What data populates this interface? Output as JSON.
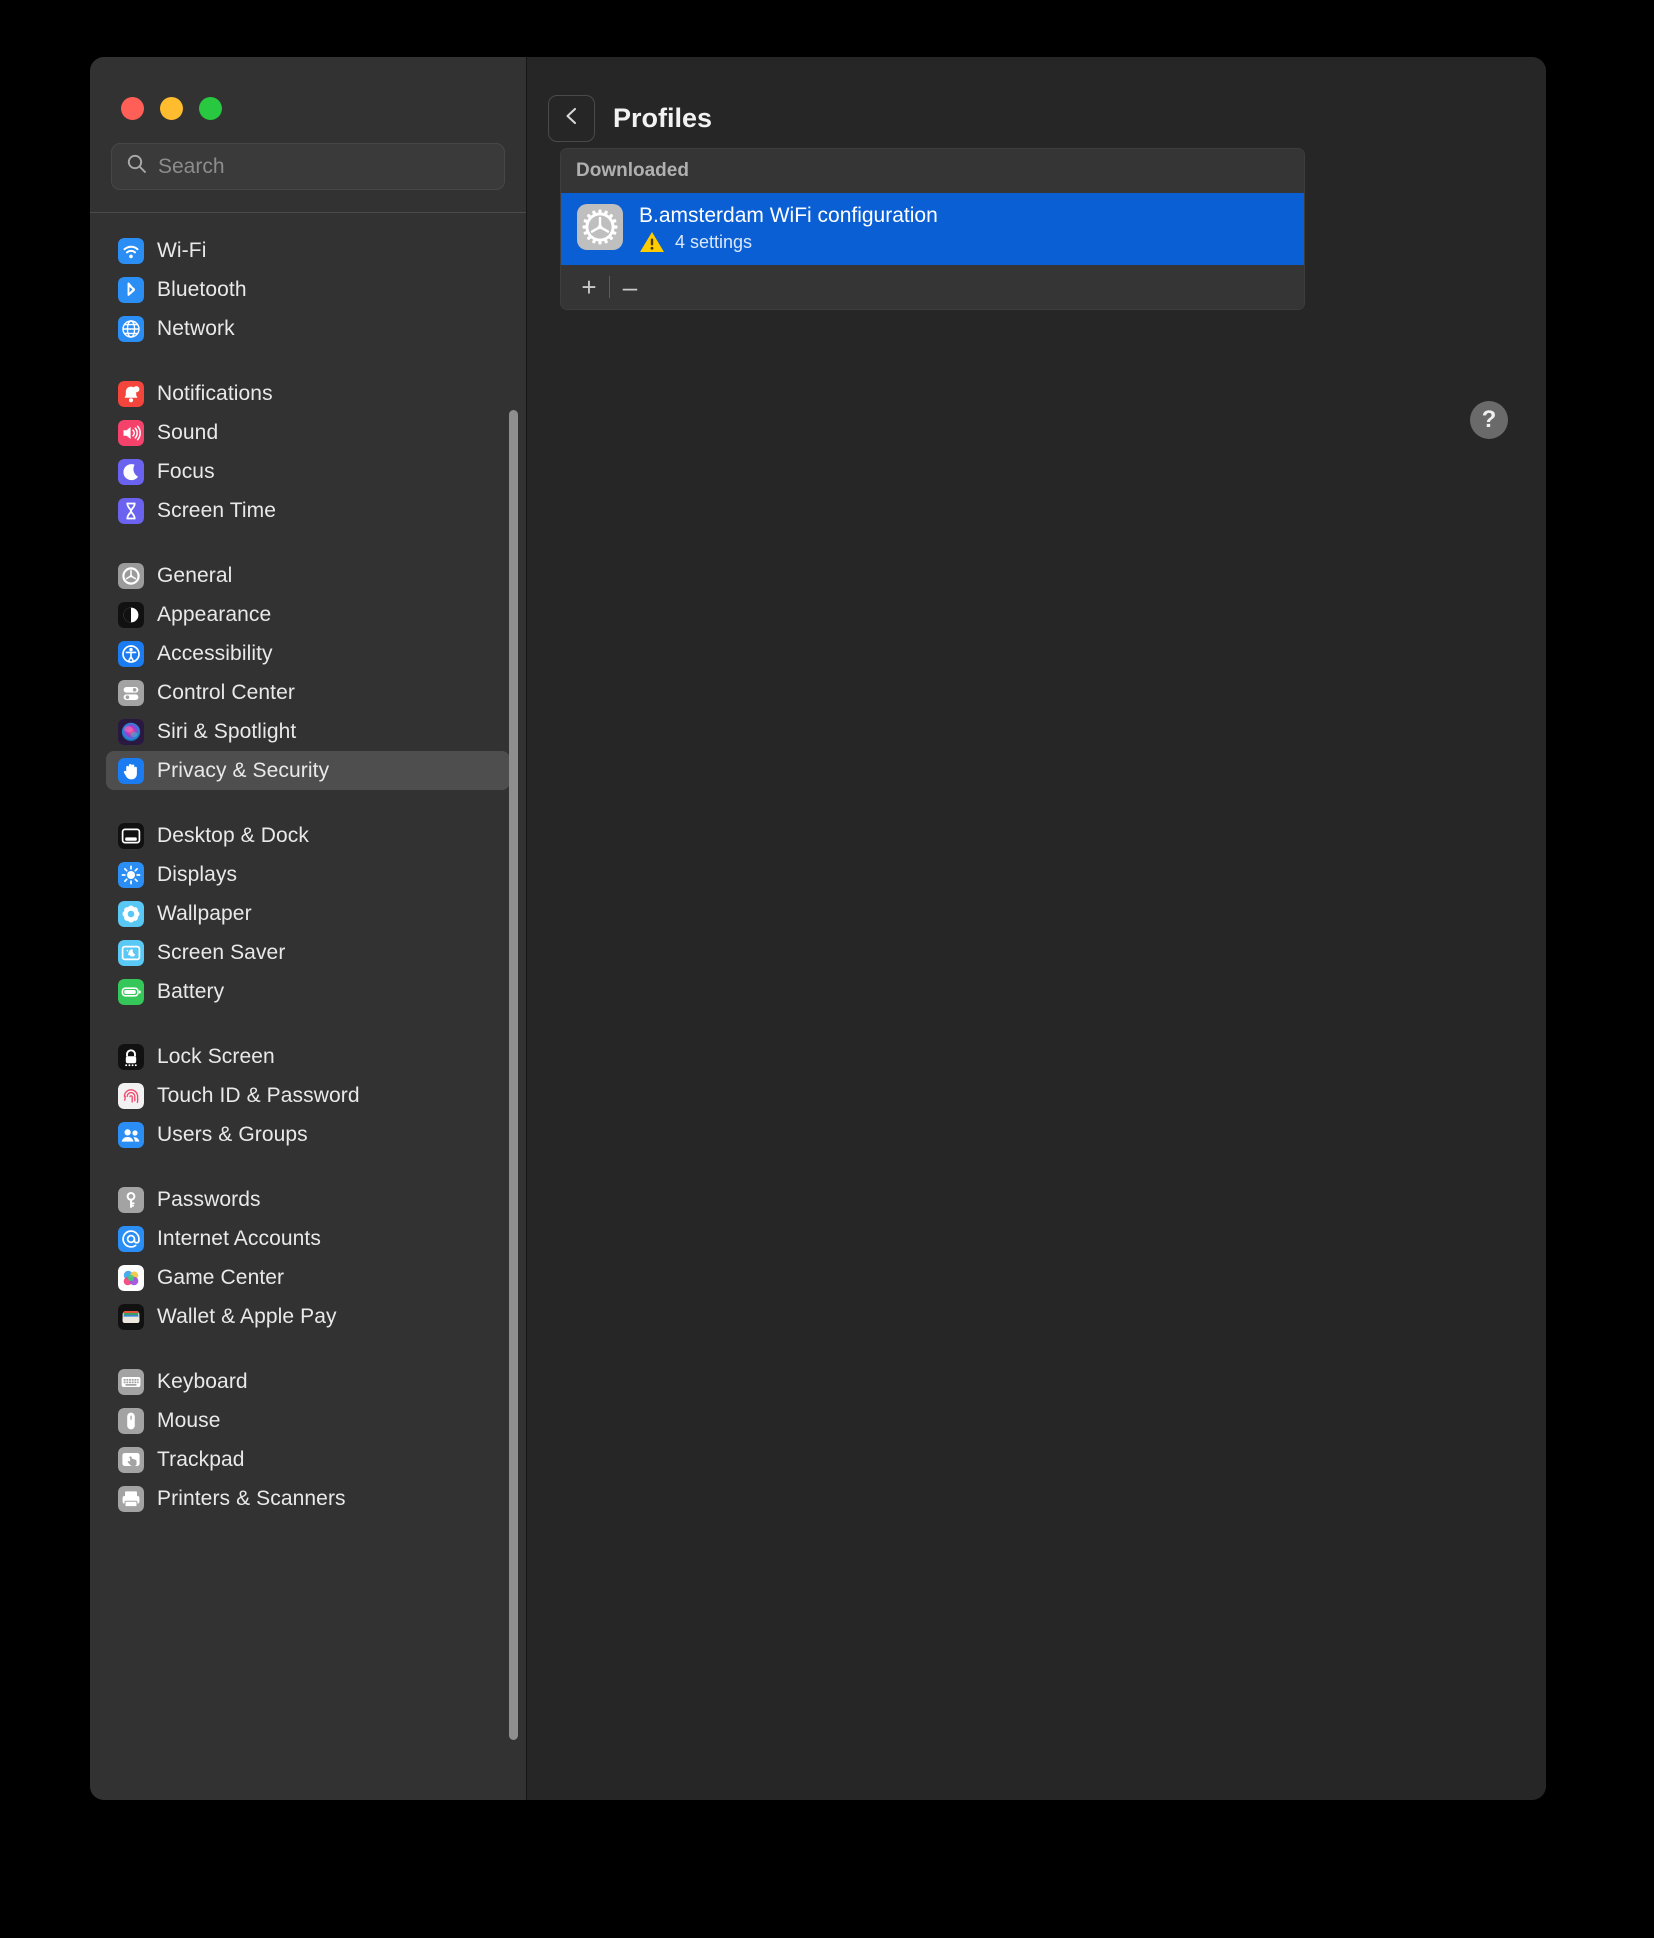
{
  "window": {
    "traffic_lights": {
      "close": "close-button",
      "minimize": "minimize-button",
      "maximize": "maximize-button",
      "close_color": "#ff5f57",
      "minimize_color": "#febc2e",
      "maximize_color": "#28c840"
    }
  },
  "search": {
    "placeholder": "Search",
    "value": ""
  },
  "sidebar": {
    "groups": [
      {
        "items": [
          {
            "label": "Wi-Fi",
            "icon": "wifi-icon",
            "icon_bg": "#2b8ef5",
            "selected": false
          },
          {
            "label": "Bluetooth",
            "icon": "bluetooth-icon",
            "icon_bg": "#2b8ef5",
            "selected": false
          },
          {
            "label": "Network",
            "icon": "globe-icon",
            "icon_bg": "#2b8ef5",
            "selected": false
          }
        ]
      },
      {
        "items": [
          {
            "label": "Notifications",
            "icon": "bell-icon",
            "icon_bg": "#f3453b",
            "selected": false
          },
          {
            "label": "Sound",
            "icon": "speaker-icon",
            "icon_bg": "#f4426b",
            "selected": false
          },
          {
            "label": "Focus",
            "icon": "moon-icon",
            "icon_bg": "#6b63f0",
            "selected": false
          },
          {
            "label": "Screen Time",
            "icon": "hourglass-icon",
            "icon_bg": "#6b63f0",
            "selected": false
          }
        ]
      },
      {
        "items": [
          {
            "label": "General",
            "icon": "gear-icon",
            "icon_bg": "#9b9b9b",
            "selected": false
          },
          {
            "label": "Appearance",
            "icon": "contrast-icon",
            "icon_bg": "#111111",
            "selected": false
          },
          {
            "label": "Accessibility",
            "icon": "accessibility-icon",
            "icon_bg": "#1a7cf0",
            "selected": false
          },
          {
            "label": "Control Center",
            "icon": "sliders-icon",
            "icon_bg": "#a3a3a3",
            "selected": false
          },
          {
            "label": "Siri & Spotlight",
            "icon": "siri-icon",
            "icon_bg": "#5a2d6e",
            "selected": false
          },
          {
            "label": "Privacy & Security",
            "icon": "hand-icon",
            "icon_bg": "#1a7cf0",
            "selected": true
          }
        ]
      },
      {
        "items": [
          {
            "label": "Desktop & Dock",
            "icon": "desktop-dock-icon",
            "icon_bg": "#111111",
            "selected": false
          },
          {
            "label": "Displays",
            "icon": "brightness-icon",
            "icon_bg": "#2b8ef5",
            "selected": false
          },
          {
            "label": "Wallpaper",
            "icon": "flower-icon",
            "icon_bg": "#5ac8f5",
            "selected": false
          },
          {
            "label": "Screen Saver",
            "icon": "screen-saver-icon",
            "icon_bg": "#5ac8f5",
            "selected": false
          },
          {
            "label": "Battery",
            "icon": "battery-icon",
            "icon_bg": "#35c759",
            "selected": false
          }
        ]
      },
      {
        "items": [
          {
            "label": "Lock Screen",
            "icon": "lock-icon",
            "icon_bg": "#111111",
            "selected": false
          },
          {
            "label": "Touch ID & Password",
            "icon": "fingerprint-icon",
            "icon_bg": "#f0f0f0",
            "selected": false
          },
          {
            "label": "Users & Groups",
            "icon": "users-icon",
            "icon_bg": "#2b8ef5",
            "selected": false
          }
        ]
      },
      {
        "items": [
          {
            "label": "Passwords",
            "icon": "key-icon",
            "icon_bg": "#a3a3a3",
            "selected": false
          },
          {
            "label": "Internet Accounts",
            "icon": "at-sign-icon",
            "icon_bg": "#2b8ef5",
            "selected": false
          },
          {
            "label": "Game Center",
            "icon": "game-center-icon",
            "icon_bg": "#ffffff",
            "selected": false
          },
          {
            "label": "Wallet & Apple Pay",
            "icon": "wallet-icon",
            "icon_bg": "#111111",
            "selected": false
          }
        ]
      },
      {
        "items": [
          {
            "label": "Keyboard",
            "icon": "keyboard-icon",
            "icon_bg": "#a3a3a3",
            "selected": false
          },
          {
            "label": "Mouse",
            "icon": "mouse-icon",
            "icon_bg": "#a3a3a3",
            "selected": false
          },
          {
            "label": "Trackpad",
            "icon": "trackpad-icon",
            "icon_bg": "#a3a3a3",
            "selected": false
          },
          {
            "label": "Printers & Scanners",
            "icon": "printer-icon",
            "icon_bg": "#a3a3a3",
            "selected": false
          }
        ]
      }
    ]
  },
  "detail": {
    "back_button": "back-icon",
    "title": "Profiles",
    "card": {
      "section_label": "Downloaded",
      "rows": [
        {
          "icon": "gear-profile-icon",
          "name": "B.amsterdam WiFi configuration",
          "warning_icon": "warning-triangle-icon",
          "settings_count": "4 settings",
          "selected": true,
          "selected_color": "#0a5fd4"
        }
      ],
      "add_button": "+",
      "remove_button": "–"
    },
    "help_button": "?"
  }
}
